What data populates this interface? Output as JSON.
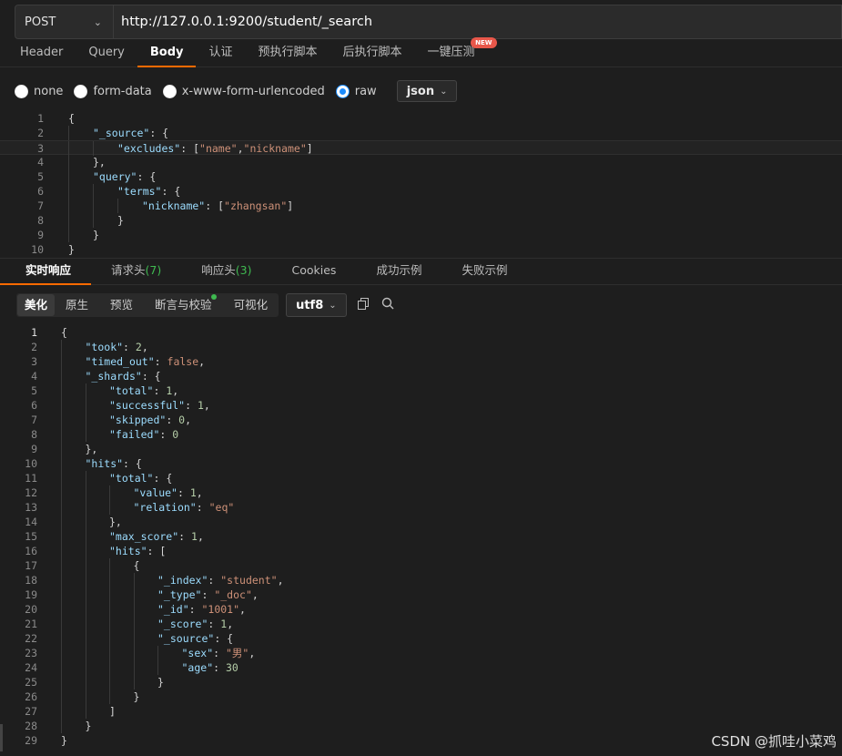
{
  "request": {
    "method": "POST",
    "url": "http://127.0.0.1:9200/student/_search"
  },
  "request_tabs": [
    {
      "label": "Header"
    },
    {
      "label": "Query"
    },
    {
      "label": "Body"
    },
    {
      "label": "认证"
    },
    {
      "label": "预执行脚本"
    },
    {
      "label": "后执行脚本"
    },
    {
      "label": "一键压测",
      "badge": "NEW"
    }
  ],
  "body_types": [
    {
      "label": "none",
      "checked": false
    },
    {
      "label": "form-data",
      "checked": false
    },
    {
      "label": "x-www-form-urlencoded",
      "checked": false
    },
    {
      "label": "raw",
      "checked": true
    }
  ],
  "body_format": "json",
  "request_body": [
    {
      "n": "1",
      "ind": 0,
      "tokens": [
        [
          "p",
          "{"
        ]
      ]
    },
    {
      "n": "2",
      "ind": 1,
      "tokens": [
        [
          "k",
          "\"_source\""
        ],
        [
          "p",
          ": {"
        ]
      ]
    },
    {
      "n": "3",
      "ind": 2,
      "tokens": [
        [
          "k",
          "\"excludes\""
        ],
        [
          "p",
          ": ["
        ],
        [
          "s",
          "\"name\""
        ],
        [
          "p",
          ","
        ],
        [
          "s",
          "\"nickname\""
        ],
        [
          "p",
          "]"
        ]
      ]
    },
    {
      "n": "4",
      "ind": 1,
      "tokens": [
        [
          "p",
          "},"
        ]
      ]
    },
    {
      "n": "5",
      "ind": 1,
      "tokens": [
        [
          "k",
          "\"query\""
        ],
        [
          "p",
          ": {"
        ]
      ]
    },
    {
      "n": "6",
      "ind": 2,
      "tokens": [
        [
          "k",
          "\"terms\""
        ],
        [
          "p",
          ": {"
        ]
      ]
    },
    {
      "n": "7",
      "ind": 3,
      "tokens": [
        [
          "k",
          "\"nickname\""
        ],
        [
          "p",
          ": ["
        ],
        [
          "s",
          "\"zhangsan\""
        ],
        [
          "p",
          "]"
        ]
      ]
    },
    {
      "n": "8",
      "ind": 2,
      "tokens": [
        [
          "p",
          "}"
        ]
      ]
    },
    {
      "n": "9",
      "ind": 1,
      "tokens": [
        [
          "p",
          "}"
        ]
      ]
    },
    {
      "n": "10",
      "ind": 0,
      "tokens": [
        [
          "p",
          "}"
        ]
      ]
    }
  ],
  "response_tabs": [
    {
      "label": "实时响应",
      "count": ""
    },
    {
      "label": "请求头",
      "count": "(7)"
    },
    {
      "label": "响应头",
      "count": "(3)"
    },
    {
      "label": "Cookies",
      "count": ""
    },
    {
      "label": "成功示例",
      "count": ""
    },
    {
      "label": "失败示例",
      "count": ""
    }
  ],
  "view_modes": [
    {
      "label": "美化"
    },
    {
      "label": "原生"
    },
    {
      "label": "预览"
    },
    {
      "label": "断言与校验"
    },
    {
      "label": "可视化"
    }
  ],
  "encoding": "utf8",
  "response_body": [
    {
      "n": "1",
      "ind": 0,
      "tokens": [
        [
          "p",
          "{"
        ]
      ]
    },
    {
      "n": "2",
      "ind": 1,
      "tokens": [
        [
          "k",
          "\"took\""
        ],
        [
          "p",
          ": "
        ],
        [
          "n",
          "2"
        ],
        [
          "p",
          ","
        ]
      ]
    },
    {
      "n": "3",
      "ind": 1,
      "tokens": [
        [
          "k",
          "\"timed_out\""
        ],
        [
          "p",
          ": "
        ],
        [
          "b",
          "false"
        ],
        [
          "p",
          ","
        ]
      ]
    },
    {
      "n": "4",
      "ind": 1,
      "tokens": [
        [
          "k",
          "\"_shards\""
        ],
        [
          "p",
          ": {"
        ]
      ]
    },
    {
      "n": "5",
      "ind": 2,
      "tokens": [
        [
          "k",
          "\"total\""
        ],
        [
          "p",
          ": "
        ],
        [
          "n",
          "1"
        ],
        [
          "p",
          ","
        ]
      ]
    },
    {
      "n": "6",
      "ind": 2,
      "tokens": [
        [
          "k",
          "\"successful\""
        ],
        [
          "p",
          ": "
        ],
        [
          "n",
          "1"
        ],
        [
          "p",
          ","
        ]
      ]
    },
    {
      "n": "7",
      "ind": 2,
      "tokens": [
        [
          "k",
          "\"skipped\""
        ],
        [
          "p",
          ": "
        ],
        [
          "n",
          "0"
        ],
        [
          "p",
          ","
        ]
      ]
    },
    {
      "n": "8",
      "ind": 2,
      "tokens": [
        [
          "k",
          "\"failed\""
        ],
        [
          "p",
          ": "
        ],
        [
          "n",
          "0"
        ]
      ]
    },
    {
      "n": "9",
      "ind": 1,
      "tokens": [
        [
          "p",
          "},"
        ]
      ]
    },
    {
      "n": "10",
      "ind": 1,
      "tokens": [
        [
          "k",
          "\"hits\""
        ],
        [
          "p",
          ": {"
        ]
      ]
    },
    {
      "n": "11",
      "ind": 2,
      "tokens": [
        [
          "k",
          "\"total\""
        ],
        [
          "p",
          ": {"
        ]
      ]
    },
    {
      "n": "12",
      "ind": 3,
      "tokens": [
        [
          "k",
          "\"value\""
        ],
        [
          "p",
          ": "
        ],
        [
          "n",
          "1"
        ],
        [
          "p",
          ","
        ]
      ]
    },
    {
      "n": "13",
      "ind": 3,
      "tokens": [
        [
          "k",
          "\"relation\""
        ],
        [
          "p",
          ": "
        ],
        [
          "s",
          "\"eq\""
        ]
      ]
    },
    {
      "n": "14",
      "ind": 2,
      "tokens": [
        [
          "p",
          "},"
        ]
      ]
    },
    {
      "n": "15",
      "ind": 2,
      "tokens": [
        [
          "k",
          "\"max_score\""
        ],
        [
          "p",
          ": "
        ],
        [
          "n",
          "1"
        ],
        [
          "p",
          ","
        ]
      ]
    },
    {
      "n": "16",
      "ind": 2,
      "tokens": [
        [
          "k",
          "\"hits\""
        ],
        [
          "p",
          ": ["
        ]
      ]
    },
    {
      "n": "17",
      "ind": 3,
      "tokens": [
        [
          "p",
          "{"
        ]
      ]
    },
    {
      "n": "18",
      "ind": 4,
      "tokens": [
        [
          "k",
          "\"_index\""
        ],
        [
          "p",
          ": "
        ],
        [
          "s",
          "\"student\""
        ],
        [
          "p",
          ","
        ]
      ]
    },
    {
      "n": "19",
      "ind": 4,
      "tokens": [
        [
          "k",
          "\"_type\""
        ],
        [
          "p",
          ": "
        ],
        [
          "s",
          "\"_doc\""
        ],
        [
          "p",
          ","
        ]
      ]
    },
    {
      "n": "20",
      "ind": 4,
      "tokens": [
        [
          "k",
          "\"_id\""
        ],
        [
          "p",
          ": "
        ],
        [
          "s",
          "\"1001\""
        ],
        [
          "p",
          ","
        ]
      ]
    },
    {
      "n": "21",
      "ind": 4,
      "tokens": [
        [
          "k",
          "\"_score\""
        ],
        [
          "p",
          ": "
        ],
        [
          "n",
          "1"
        ],
        [
          "p",
          ","
        ]
      ]
    },
    {
      "n": "22",
      "ind": 4,
      "tokens": [
        [
          "k",
          "\"_source\""
        ],
        [
          "p",
          ": {"
        ]
      ]
    },
    {
      "n": "23",
      "ind": 5,
      "tokens": [
        [
          "k",
          "\"sex\""
        ],
        [
          "p",
          ": "
        ],
        [
          "s",
          "\"男\""
        ],
        [
          "p",
          ","
        ]
      ]
    },
    {
      "n": "24",
      "ind": 5,
      "tokens": [
        [
          "k",
          "\"age\""
        ],
        [
          "p",
          ": "
        ],
        [
          "n",
          "30"
        ]
      ]
    },
    {
      "n": "25",
      "ind": 4,
      "tokens": [
        [
          "p",
          "}"
        ]
      ]
    },
    {
      "n": "26",
      "ind": 3,
      "tokens": [
        [
          "p",
          "}"
        ]
      ]
    },
    {
      "n": "27",
      "ind": 2,
      "tokens": [
        [
          "p",
          "]"
        ]
      ]
    },
    {
      "n": "28",
      "ind": 1,
      "tokens": [
        [
          "p",
          "}"
        ]
      ]
    },
    {
      "n": "29",
      "ind": 0,
      "tokens": [
        [
          "p",
          "}"
        ]
      ]
    }
  ],
  "watermark": "CSDN @抓哇小菜鸡",
  "colors": {
    "accent": "#ff6a00",
    "key": "#9cdcfe",
    "string": "#ce9178",
    "number": "#b5cea8",
    "count": "#3fb950",
    "radio_checked": "#1a8cff"
  }
}
